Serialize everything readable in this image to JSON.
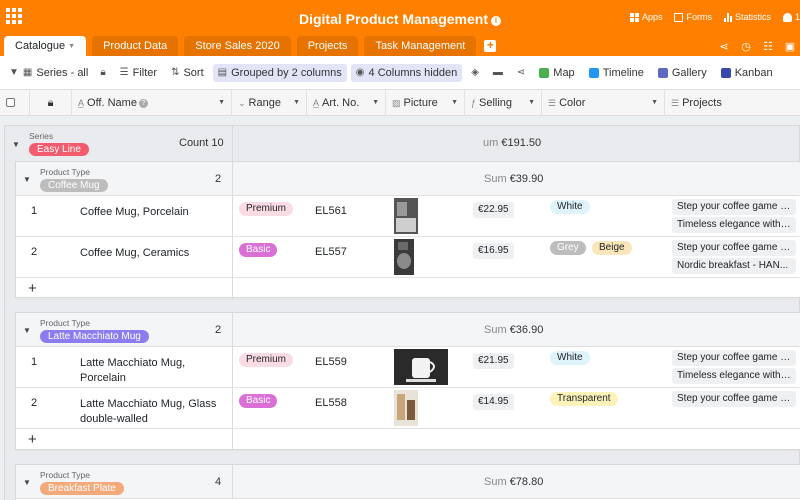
{
  "app": {
    "title": "Digital Product Management",
    "header_links": [
      {
        "label": "Apps",
        "icon": "apps-icon"
      },
      {
        "label": "Forms",
        "icon": "forms-icon"
      },
      {
        "label": "Statistics",
        "icon": "statistics-icon"
      },
      {
        "label": "1",
        "icon": "user-icon"
      }
    ],
    "accent": "#ff8000"
  },
  "tabs": [
    {
      "label": "Catalogue",
      "active": true
    },
    {
      "label": "Product Data"
    },
    {
      "label": "Store Sales 2020"
    },
    {
      "label": "Projects"
    },
    {
      "label": "Task Management"
    }
  ],
  "toolbar": {
    "view": "Series - all",
    "filter": "Filter",
    "sort": "Sort",
    "group": "Grouped by 2 columns",
    "hidden": "4 Columns hidden",
    "map": "Map",
    "timeline": "Timeline",
    "gallery": "Gallery",
    "kanban": "Kanban"
  },
  "columns": {
    "name": "Off. Name",
    "range": "Range",
    "art": "Art. No.",
    "picture": "Picture",
    "selling": "Selling",
    "color": "Color",
    "projects": "Projects"
  },
  "group1": {
    "label": "Series",
    "value": "Easy Line",
    "count_label": "Count",
    "count": "10",
    "sum_label": "um",
    "sum": "€191.50"
  },
  "subgroups": [
    {
      "label": "Product Type",
      "value": "Coffee Mug",
      "count": "2",
      "sum_label": "Sum",
      "sum": "€39.90",
      "rows": [
        {
          "num": "1",
          "name": "Coffee Mug, Porcelain",
          "range": "Premium",
          "art": "EL561",
          "price": "€22.95",
          "colors": [
            "White"
          ],
          "projects": [
            "Step your coffee game up",
            "Timeless elegance with ..."
          ]
        },
        {
          "num": "2",
          "name": "Coffee Mug, Ceramics",
          "range": "Basic",
          "art": "EL557",
          "price": "€16.95",
          "colors": [
            "Grey",
            "Beige"
          ],
          "projects": [
            "Step your coffee game up",
            "Nordic breakfast - HAN..."
          ]
        }
      ]
    },
    {
      "label": "Product Type",
      "value": "Latte Macchiato Mug",
      "count": "2",
      "sum_label": "Sum",
      "sum": "€36.90",
      "rows": [
        {
          "num": "1",
          "name": "Latte Macchiato Mug, Porcelain",
          "range": "Premium",
          "art": "EL559",
          "price": "€21.95",
          "colors": [
            "White"
          ],
          "projects": [
            "Step your coffee game up",
            "Timeless elegance with ..."
          ]
        },
        {
          "num": "2",
          "name": "Latte Macchiato Mug, Glass double-walled",
          "range": "Basic",
          "art": "EL558",
          "price": "€14.95",
          "colors": [
            "Transparent"
          ],
          "projects": [
            "Step your coffee game up"
          ]
        }
      ]
    },
    {
      "label": "Product Type",
      "value": "Breakfast Plate",
      "count": "4",
      "sum_label": "Sum",
      "sum": "€78.80",
      "rows": []
    }
  ],
  "add_row": "+"
}
